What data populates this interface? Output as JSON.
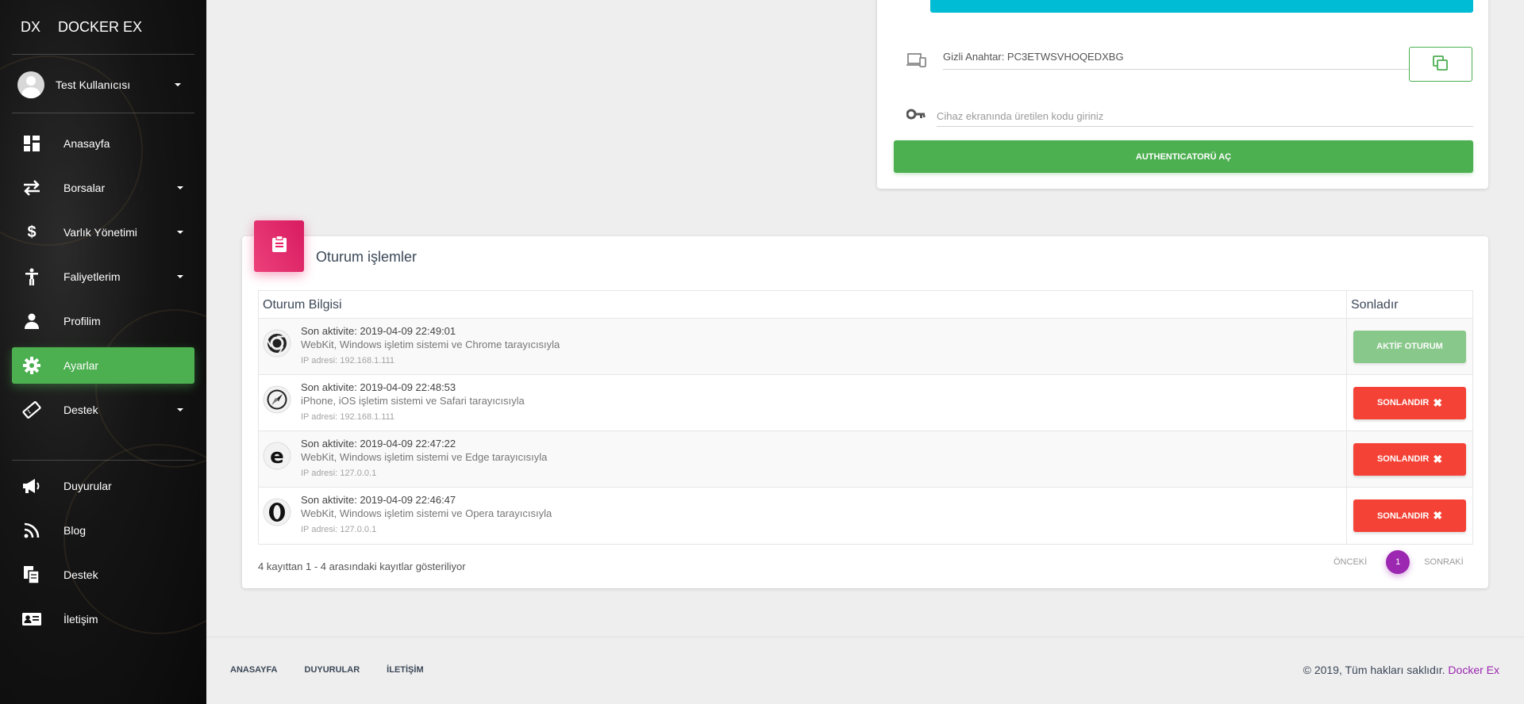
{
  "sidebar": {
    "logo_short": "DX",
    "logo_full": "DOCKER EX",
    "user_name": "Test Kullanıcısı",
    "items": [
      {
        "label": "Anasayfa",
        "icon": "dashboard-icon"
      },
      {
        "label": "Borsalar",
        "icon": "swap-icon"
      },
      {
        "label": "Varlık Yönetimi",
        "icon": "dollar-icon"
      },
      {
        "label": "Faliyetlerim",
        "icon": "accessibility-icon"
      },
      {
        "label": "Profilim",
        "icon": "person-icon"
      },
      {
        "label": "Ayarlar",
        "icon": "gear-icon",
        "active": true
      },
      {
        "label": "Destek",
        "icon": "ticket-icon"
      }
    ],
    "secondary_items": [
      {
        "label": "Duyurular",
        "icon": "megaphone-icon"
      },
      {
        "label": "Blog",
        "icon": "rss-icon"
      },
      {
        "label": "Destek",
        "icon": "document-icon"
      },
      {
        "label": "İletişim",
        "icon": "contact-card-icon"
      }
    ]
  },
  "authenticator": {
    "secret_label": "Gizli Anahtar: PC3ETWSVHOQEDXBG",
    "code_placeholder": "Cihaz ekranında üretilen kodu giriniz",
    "submit_label": "AUTHENTICATORÜ AÇ"
  },
  "sessions": {
    "title": "Oturum işlemler",
    "col_info": "Oturum Bilgisi",
    "col_end": "Sonladır",
    "rows": [
      {
        "activity": "Son aktivite: 2019-04-09 22:49:01",
        "desc": "WebKit, Windows işletim sistemi ve Chrome tarayıcısıyla",
        "ip": "IP adresi: 192.168.1.111",
        "browser_icon": "chrome-icon",
        "action": "AKTİF OTURUM",
        "active": true
      },
      {
        "activity": "Son aktivite: 2019-04-09 22:48:53",
        "desc": "iPhone, iOS işletim sistemi ve Safari tarayıcısıyla",
        "ip": "IP adresi: 192.168.1.111",
        "browser_icon": "safari-icon",
        "action": "SONLANDIR",
        "active": false
      },
      {
        "activity": "Son aktivite: 2019-04-09 22:47:22",
        "desc": "WebKit, Windows işletim sistemi ve Edge tarayıcısıyla",
        "ip": "IP adresi: 127.0.0.1",
        "browser_icon": "edge-icon",
        "action": "SONLANDIR",
        "active": false
      },
      {
        "activity": "Son aktivite: 2019-04-09 22:46:47",
        "desc": "WebKit, Windows işletim sistemi ve Opera tarayıcısıyla",
        "ip": "IP adresi: 127.0.0.1",
        "browser_icon": "opera-icon",
        "action": "SONLANDIR",
        "active": false
      }
    ],
    "summary": "4 kayıttan 1 - 4 arasındaki kayıtlar gösteriliyor",
    "pager": {
      "prev": "ÖNCEKİ",
      "current": "1",
      "next": "SONRAKİ"
    }
  },
  "footer": {
    "links": [
      "ANASAYFA",
      "DUYURULAR",
      "İLETİŞİM"
    ],
    "copyright": "© 2019, Tüm hakları saklıdır.",
    "brand": "Docker Ex"
  },
  "colors": {
    "accent_green": "#4caf50",
    "danger_red": "#f44336",
    "accent_cyan": "#00bcd4",
    "accent_pink": "#e91e63",
    "accent_purple": "#9c27b0"
  }
}
